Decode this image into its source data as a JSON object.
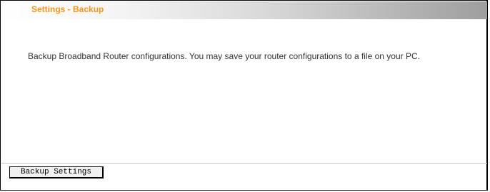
{
  "header": {
    "title": "Settings - Backup"
  },
  "main": {
    "description": "Backup Broadband Router configurations. You may save your router configurations to a file on your PC."
  },
  "actions": {
    "backup_label": "Backup Settings"
  },
  "colors": {
    "title_accent": "#f7941d",
    "title_bar_start": "#ffffff",
    "title_bar_end": "#9e9e9e",
    "border": "#000000"
  }
}
